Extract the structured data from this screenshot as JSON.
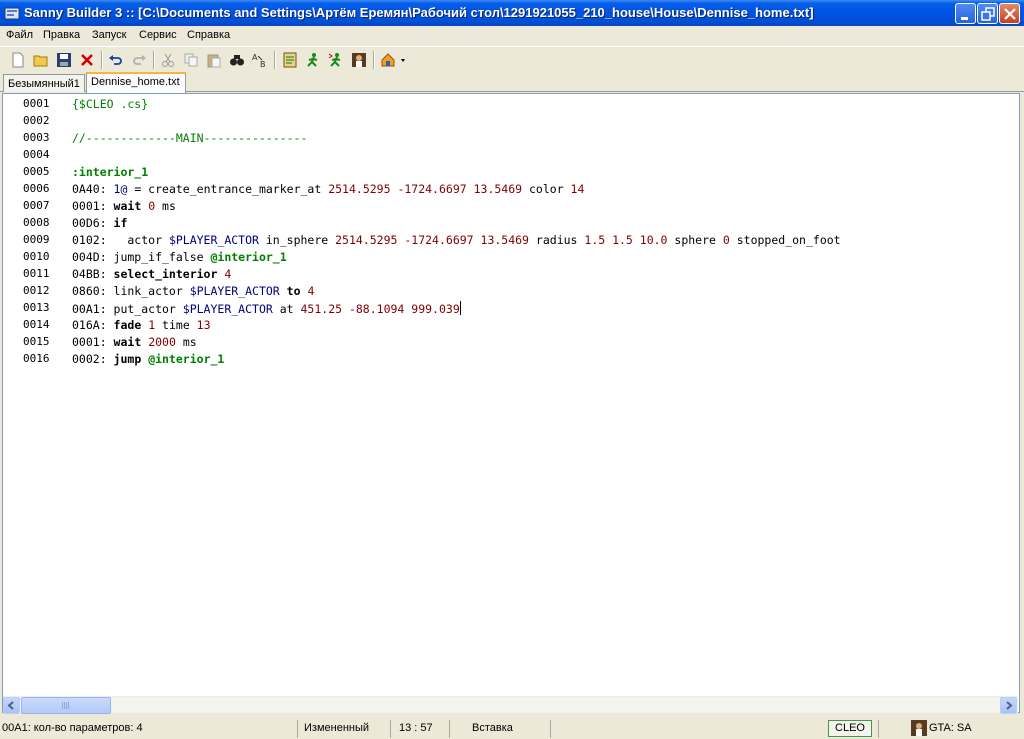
{
  "window": {
    "title": "Sanny Builder 3 :: [C:\\Documents and Settings\\Артём Еремян\\Рабочий стол\\1291921055_210_house\\House\\Dennise_home.txt]"
  },
  "menu": {
    "items": [
      "Файл",
      "Правка",
      "Запуск",
      "Сервис",
      "Справка"
    ]
  },
  "toolbar": {
    "buttons": [
      "new-file-icon",
      "open-folder-icon",
      "save-icon",
      "close-icon",
      "undo-icon",
      "redo-icon",
      "cut-icon",
      "copy-icon",
      "paste-icon",
      "find-icon",
      "replace-icon",
      "compile-icon",
      "run-icon",
      "run-alt-icon",
      "game-icon",
      "edit-mode-icon"
    ]
  },
  "tabs": [
    {
      "label": "Безымянный1",
      "active": false
    },
    {
      "label": "Dennise_home.txt",
      "active": true
    }
  ],
  "editor": {
    "lines": [
      {
        "num": "0001",
        "tokens": [
          {
            "t": "{$CLEO .cs}",
            "c": "dir"
          }
        ]
      },
      {
        "num": "0002",
        "tokens": []
      },
      {
        "num": "0003",
        "tokens": [
          {
            "t": "//-------------MAIN---------------",
            "c": "comment"
          }
        ]
      },
      {
        "num": "0004",
        "tokens": []
      },
      {
        "num": "0005",
        "tokens": [
          {
            "t": ":interior_1",
            "c": "label"
          }
        ]
      },
      {
        "num": "0006",
        "tokens": [
          {
            "t": "0A40: ",
            "c": "plain"
          },
          {
            "t": "1@",
            "c": "var"
          },
          {
            "t": " = create_entrance_marker_at ",
            "c": "plain"
          },
          {
            "t": "2514.5295 -1724.6697 13.5469",
            "c": "num"
          },
          {
            "t": " color ",
            "c": "plain"
          },
          {
            "t": "14",
            "c": "num"
          }
        ]
      },
      {
        "num": "0007",
        "tokens": [
          {
            "t": "0001: ",
            "c": "plain"
          },
          {
            "t": "wait",
            "c": "kw"
          },
          {
            "t": " ",
            "c": "plain"
          },
          {
            "t": "0",
            "c": "num"
          },
          {
            "t": " ms",
            "c": "plain"
          }
        ]
      },
      {
        "num": "0008",
        "tokens": [
          {
            "t": "00D6: ",
            "c": "plain"
          },
          {
            "t": "if",
            "c": "kw"
          }
        ]
      },
      {
        "num": "0009",
        "tokens": [
          {
            "t": "0102:   actor ",
            "c": "plain"
          },
          {
            "t": "$PLAYER_ACTOR",
            "c": "var"
          },
          {
            "t": " in_sphere ",
            "c": "plain"
          },
          {
            "t": "2514.5295 -1724.6697 13.5469",
            "c": "num"
          },
          {
            "t": " radius ",
            "c": "plain"
          },
          {
            "t": "1.5 1.5 10.0",
            "c": "num"
          },
          {
            "t": " sphere ",
            "c": "plain"
          },
          {
            "t": "0",
            "c": "num"
          },
          {
            "t": " stopped_on_foot",
            "c": "plain"
          }
        ]
      },
      {
        "num": "0010",
        "tokens": [
          {
            "t": "004D: jump_if_false ",
            "c": "plain"
          },
          {
            "t": "@interior_1",
            "c": "label"
          }
        ]
      },
      {
        "num": "0011",
        "tokens": [
          {
            "t": "04BB: ",
            "c": "plain"
          },
          {
            "t": "select_interior",
            "c": "kw"
          },
          {
            "t": " ",
            "c": "plain"
          },
          {
            "t": "4",
            "c": "num"
          }
        ]
      },
      {
        "num": "0012",
        "tokens": [
          {
            "t": "0860: link_actor ",
            "c": "plain"
          },
          {
            "t": "$PLAYER_ACTOR",
            "c": "var"
          },
          {
            "t": " ",
            "c": "plain"
          },
          {
            "t": "to",
            "c": "kw"
          },
          {
            "t": " ",
            "c": "plain"
          },
          {
            "t": "4",
            "c": "num"
          }
        ]
      },
      {
        "num": "0013",
        "tokens": [
          {
            "t": "00A1: put_actor ",
            "c": "plain"
          },
          {
            "t": "$PLAYER_ACTOR",
            "c": "var"
          },
          {
            "t": " at ",
            "c": "plain"
          },
          {
            "t": "451.25 -88.1094 999.039",
            "c": "num"
          }
        ],
        "caret": true
      },
      {
        "num": "0014",
        "tokens": [
          {
            "t": "016A: ",
            "c": "plain"
          },
          {
            "t": "fade",
            "c": "kw"
          },
          {
            "t": " ",
            "c": "plain"
          },
          {
            "t": "1",
            "c": "num"
          },
          {
            "t": " time ",
            "c": "plain"
          },
          {
            "t": "13",
            "c": "num"
          }
        ]
      },
      {
        "num": "0015",
        "tokens": [
          {
            "t": "0001: ",
            "c": "plain"
          },
          {
            "t": "wait",
            "c": "kw"
          },
          {
            "t": " ",
            "c": "plain"
          },
          {
            "t": "2000",
            "c": "num"
          },
          {
            "t": " ms",
            "c": "plain"
          }
        ]
      },
      {
        "num": "0016",
        "tokens": [
          {
            "t": "0002: ",
            "c": "plain"
          },
          {
            "t": "jump",
            "c": "kw"
          },
          {
            "t": " ",
            "c": "plain"
          },
          {
            "t": "@interior_1",
            "c": "label"
          }
        ]
      }
    ]
  },
  "status": {
    "hint": "00A1: кол-во параметров: 4",
    "modified": "Измененный",
    "position": "13 : 57",
    "mode": "Вставка",
    "target": "CLEO",
    "game": "GTA: SA"
  }
}
